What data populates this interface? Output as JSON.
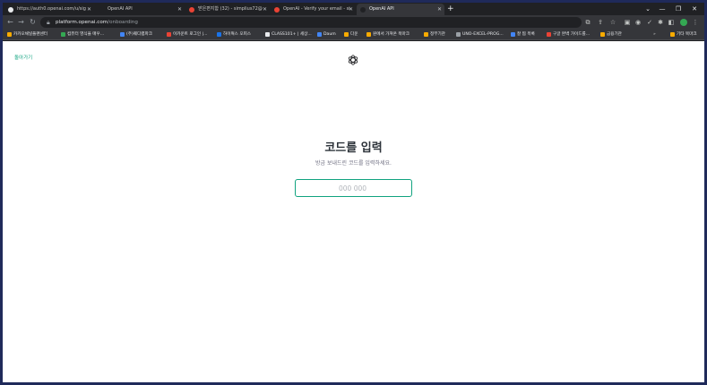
{
  "tabs": [
    {
      "title": "https://auth0.openai.com/u/sig",
      "fav_color": "#e8eaed",
      "active": false
    },
    {
      "title": "OpenAI API",
      "fav_color": "#202124",
      "active": false
    },
    {
      "title": "받은편지함 (32) - simplius72@",
      "fav_color": "#ea4335",
      "active": false
    },
    {
      "title": "OpenAI - Verify your email - si",
      "fav_color": "#ea4335",
      "active": false
    },
    {
      "title": "OpenAI API",
      "fav_color": "#202124",
      "active": true
    }
  ],
  "url": {
    "host": "platform.openai.com",
    "path": "/onboarding"
  },
  "bookmarks": [
    {
      "label": "카카오채널플랜센터",
      "color": "#f9ab00"
    },
    {
      "label": "컴퓨터 영식을 매우...",
      "color": "#34a853"
    },
    {
      "label": "(주)퀘디랩파크",
      "color": "#4285f4"
    },
    {
      "label": "이카운트 로그인 |...",
      "color": "#ea4335"
    },
    {
      "label": "하이웍스 오피스",
      "color": "#1a73e8"
    },
    {
      "label": "CLASS101+ | 세상...",
      "color": "#e8eaed"
    },
    {
      "label": "Daum",
      "color": "#4285f4"
    },
    {
      "label": "다운",
      "color": "#f9ab00"
    },
    {
      "label": "원에서 가져온 북마크",
      "color": "#f9ab00"
    },
    {
      "label": "정부기관",
      "color": "#f9ab00"
    },
    {
      "label": "UNO-EXCEL-PROG...",
      "color": "#9aa0a6"
    },
    {
      "label": "잘 찜 목록",
      "color": "#4285f4"
    },
    {
      "label": "구글 완벽 가이드를...",
      "color": "#ea4335"
    },
    {
      "label": "금융기관",
      "color": "#f9ab00"
    },
    {
      "label": "기타 북마크",
      "color": "#f9ab00"
    }
  ],
  "page": {
    "back_label": "돌아가기",
    "title": "코드를 입력",
    "subtitle": "방금 보내드린 코드를 입력하세요.",
    "code_placeholder": "000 000",
    "accent": "#10a37f"
  }
}
